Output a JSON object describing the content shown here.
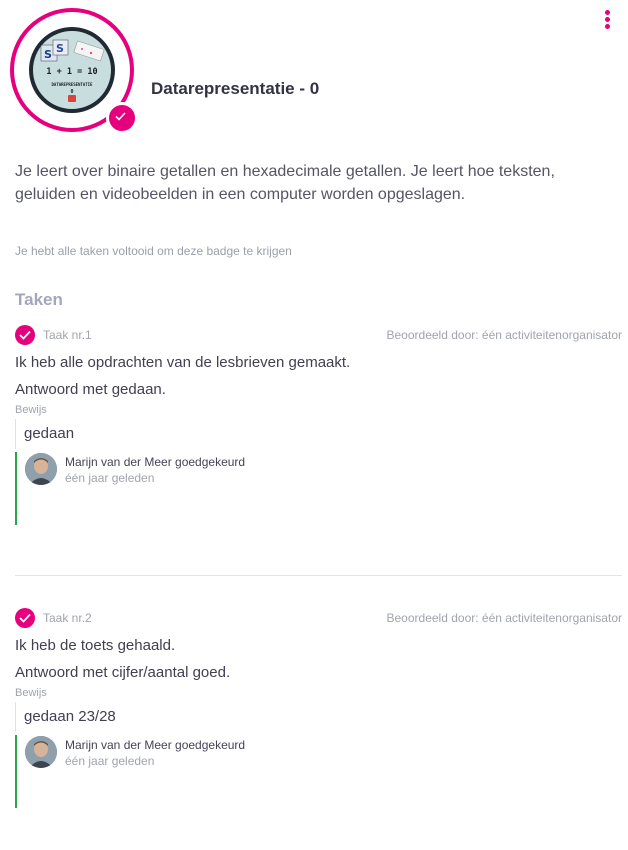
{
  "badge": {
    "title": "Datarepresentatie - 0",
    "image_text": {
      "line1": "1 + 1 = 10",
      "line2": "DATAREPRESENTATIE",
      "line3": "0"
    },
    "description": "Je leert over binaire getallen en hexadecimale getallen. Je leert hoe teksten, geluiden en videobeelden in een computer worden opgeslagen.",
    "completed_note": "Je hebt alle taken voltooid om deze badge te krijgen"
  },
  "tasks_heading": "Taken",
  "tasks": [
    {
      "number": "Taak nr.1",
      "assessor": "Beoordeeld door: één activiteitenorganisator",
      "line1": "Ik heb alle opdrachten van de lesbrieven gemaakt.",
      "line2": "Antwoord met gedaan.",
      "proof_label": "Bewijs",
      "proof": "gedaan",
      "approver": "Marijn van der Meer goedgekeurd",
      "approved_time": "één jaar geleden"
    },
    {
      "number": "Taak nr.2",
      "assessor": "Beoordeeld door: één activiteitenorganisator",
      "line1": "Ik heb de toets gehaald.",
      "line2": "Antwoord met cijfer/aantal goed.",
      "proof_label": "Bewijs",
      "proof": "gedaan 23/28",
      "approver": "Marijn van der Meer goedgekeurd",
      "approved_time": "één jaar geleden"
    }
  ],
  "colors": {
    "accent": "#e6007e",
    "approved": "#2ba34a",
    "heading": "#a5a6bd"
  },
  "icons": {
    "menu": "kebab-menu-icon",
    "check": "checkmark-icon"
  }
}
